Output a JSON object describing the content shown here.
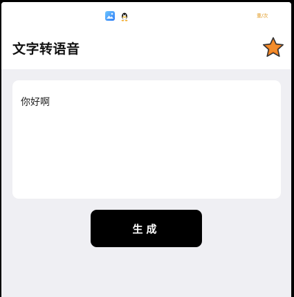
{
  "statusbar": {
    "icons": [
      "gallery-icon",
      "qq-icon"
    ],
    "right_text": "重/次"
  },
  "header": {
    "title": "文字转语音",
    "favorite_icon": "star-icon",
    "favorite_color": "#f07c1c"
  },
  "input_card": {
    "text": "你好啊"
  },
  "actions": {
    "generate_label": "生成"
  }
}
